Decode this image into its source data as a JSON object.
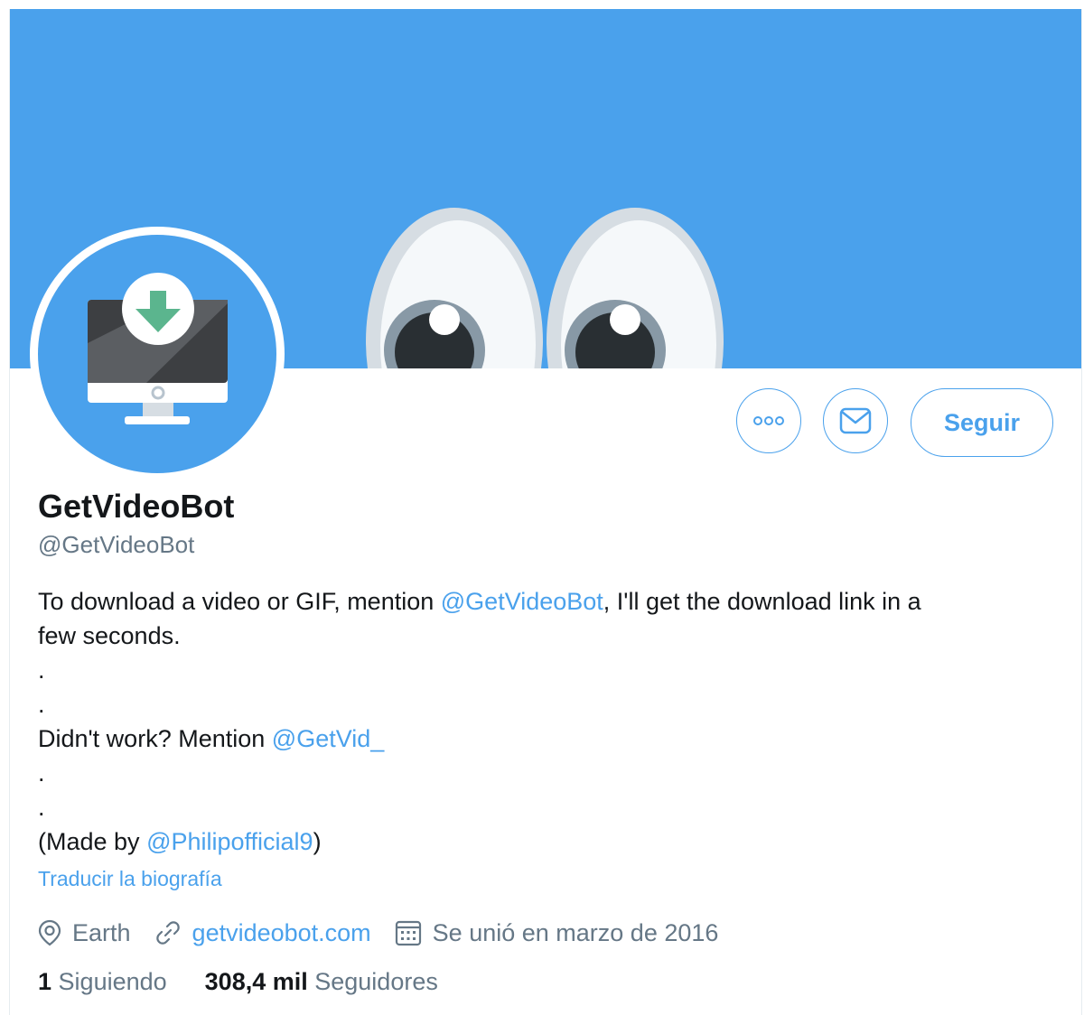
{
  "profile": {
    "name": "GetVideoBot",
    "handle": "@GetVideoBot",
    "bio": {
      "line1_pre": "To download a video or GIF, mention ",
      "line1_mention": "@GetVideoBot",
      "line1_post": ", I'll get the download link in a",
      "line2": "few seconds.",
      "dot": ".",
      "line5_pre": "Didn't work? Mention ",
      "line5_mention": "@GetVid_",
      "line8_pre": "(Made by ",
      "line8_mention": "@Philipofficial9",
      "line8_post": ")"
    },
    "translate_label": "Traducir la biografía",
    "location": "Earth",
    "website": "getvideobot.com",
    "joined": "Se unió en marzo de 2016",
    "following_count": "1",
    "following_label": "Siguiendo",
    "followers_count": "308,4 mil",
    "followers_label": "Seguidores"
  },
  "actions": {
    "more_icon": "more-icon",
    "message_icon": "envelope-icon",
    "follow_label": "Seguir"
  },
  "colors": {
    "accent": "#4aa1ec",
    "text": "#14171a",
    "secondary": "#657786"
  }
}
